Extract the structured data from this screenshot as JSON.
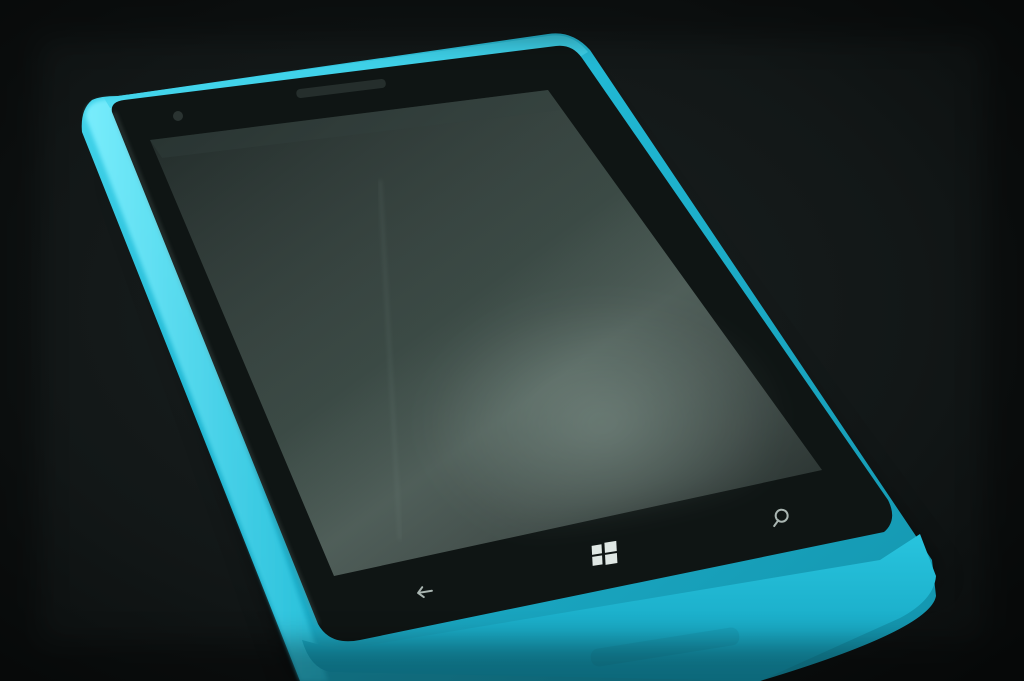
{
  "image": {
    "subject": "phone",
    "body_color": "#1fb7d4",
    "screen_color": "#1b2523",
    "background_color": "#121616"
  },
  "buttons": [
    {
      "name": "back-icon",
      "glyph": "back"
    },
    {
      "name": "windows-logo-icon",
      "glyph": "windows"
    },
    {
      "name": "search-icon",
      "glyph": "search"
    }
  ]
}
